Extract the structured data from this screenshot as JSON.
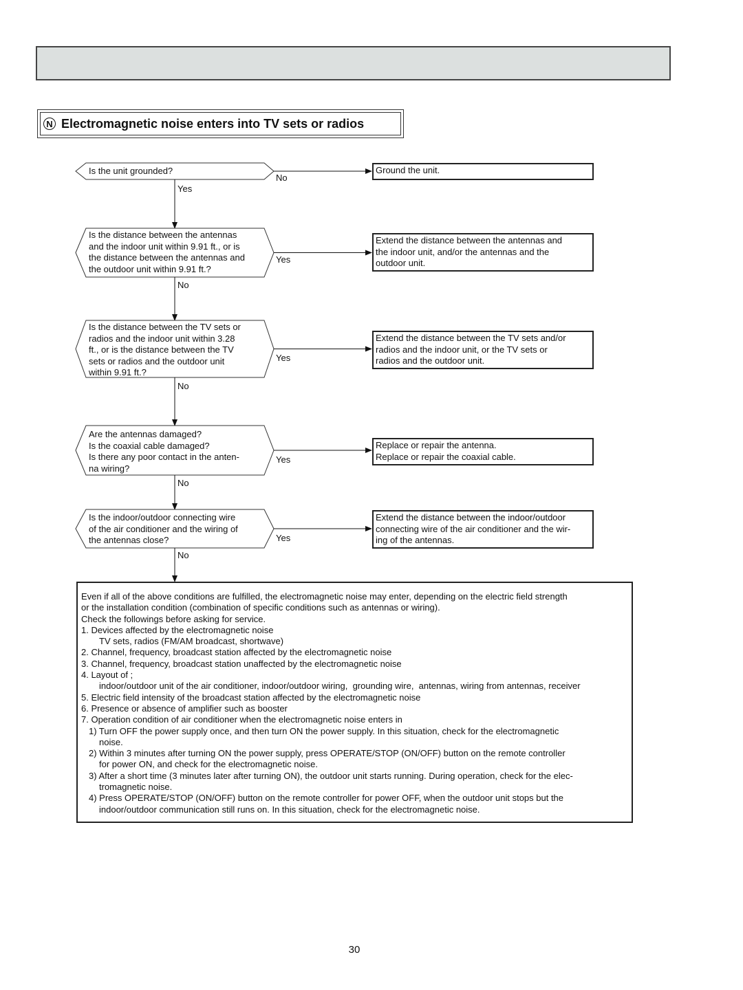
{
  "section": {
    "badge": "N",
    "title": "Electromagnetic noise enters into TV sets or radios"
  },
  "flowchart": {
    "questions": [
      {
        "text": "Is the unit grounded?",
        "branch_right_label": "No",
        "branch_down_label": "Yes",
        "action": "Ground the unit."
      },
      {
        "text": "Is the distance between the antennas\nand the indoor unit within 9.91 ft., or is\nthe distance between the antennas and\nthe outdoor unit within 9.91 ft.?",
        "branch_right_label": "Yes",
        "branch_down_label": "No",
        "action": "Extend the distance between the antennas and\nthe indoor unit, and/or the antennas and the\noutdoor unit."
      },
      {
        "text": "Is the distance between the TV sets or\nradios and the indoor unit within 3.28\nft., or is the distance between the TV\nsets or radios and the outdoor unit\nwithin 9.91 ft.?",
        "branch_right_label": "Yes",
        "branch_down_label": "No",
        "action": "Extend the distance between the TV sets and/or\nradios and the indoor unit, or the TV sets or\nradios and the outdoor unit."
      },
      {
        "text": "Are the antennas damaged?\nIs the coaxial cable damaged?\nIs there any poor contact in the anten-\nna wiring?",
        "branch_right_label": "Yes",
        "branch_down_label": "No",
        "action": "Replace or repair the antenna.\nReplace or repair the coaxial cable."
      },
      {
        "text": "Is the indoor/outdoor connecting wire\nof the air conditioner and the wiring of\nthe antennas close?",
        "branch_right_label": "Yes",
        "branch_down_label": "No",
        "action": "Extend the distance between the indoor/outdoor\nconnecting wire of the air conditioner and the wir-\ning of the antennas."
      }
    ]
  },
  "note": {
    "lines": [
      {
        "text": "Even if all of the above conditions are fulfilled, the electromagnetic noise may enter, depending on the electric field strength",
        "indent": 0
      },
      {
        "text": "or the installation condition (combination of specific conditions such as antennas or wiring).",
        "indent": 0
      },
      {
        "text": "Check the followings before asking for service.",
        "indent": 0
      },
      {
        "text": "1. Devices affected by the electromagnetic noise",
        "indent": 0
      },
      {
        "text": "TV sets, radios (FM/AM broadcast, shortwave)",
        "indent": 1
      },
      {
        "text": "2. Channel, frequency, broadcast station affected by the electromagnetic noise",
        "indent": 0
      },
      {
        "text": "3. Channel, frequency, broadcast station unaffected by the electromagnetic noise",
        "indent": 0
      },
      {
        "text": "4. Layout of ;",
        "indent": 0
      },
      {
        "text": "indoor/outdoor unit of the air conditioner, indoor/outdoor wiring,  grounding wire,  antennas, wiring from antennas, receiver",
        "indent": 1
      },
      {
        "text": "5. Electric field intensity of the broadcast station affected by the electromagnetic noise",
        "indent": 0
      },
      {
        "text": "6. Presence or absence of amplifier such as booster",
        "indent": 0
      },
      {
        "text": "7. Operation condition of air conditioner when the electromagnetic noise enters in",
        "indent": 0
      },
      {
        "text": "1) Turn OFF the power supply once, and then turn ON the power supply. In this situation, check for the electromagnetic",
        "indent": 3
      },
      {
        "text": "noise.",
        "indent": 2
      },
      {
        "text": "2) Within 3 minutes after turning ON the power supply, press OPERATE/STOP (ON/OFF) button on the remote controller",
        "indent": 3
      },
      {
        "text": "for power ON, and check for the electromagnetic noise.",
        "indent": 2
      },
      {
        "text": "3) After a short time (3 minutes later after turning ON), the outdoor unit starts running. During operation, check for the elec-",
        "indent": 3
      },
      {
        "text": "tromagnetic noise.",
        "indent": 2
      },
      {
        "text": "4) Press OPERATE/STOP (ON/OFF) button on the remote controller for power OFF, when the outdoor unit stops but the",
        "indent": 3
      },
      {
        "text": "indoor/outdoor communication still runs on. In this situation, check for the electromagnetic noise.",
        "indent": 2
      }
    ]
  },
  "page_number": "30"
}
